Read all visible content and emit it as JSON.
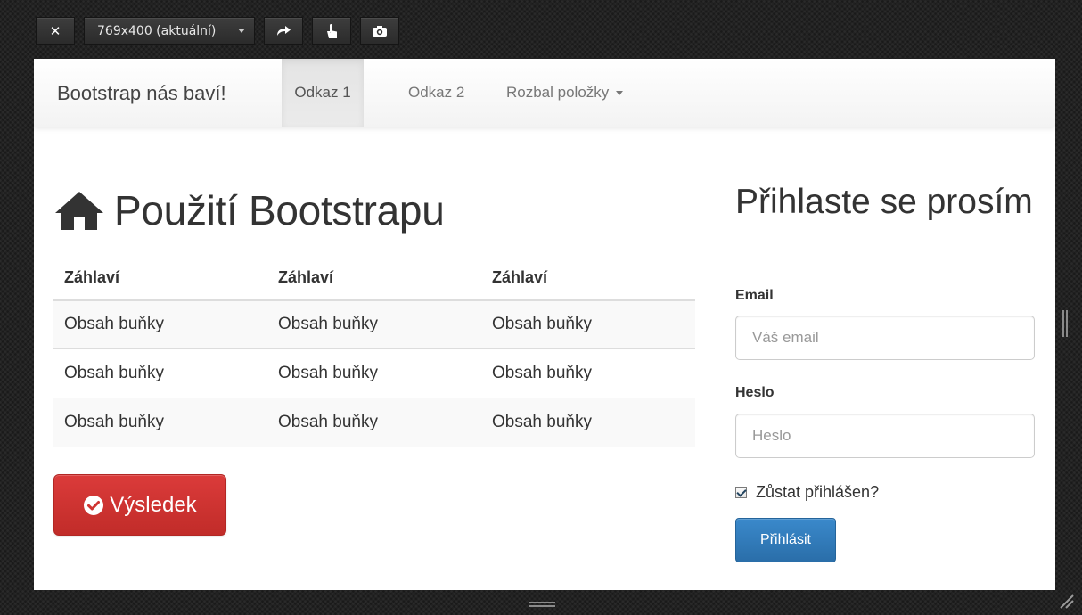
{
  "emulator": {
    "close_icon": "close-icon",
    "viewport_size": "769x400 (aktuální)",
    "icons": [
      "rotate-icon",
      "touch-icon",
      "camera-icon"
    ]
  },
  "navbar": {
    "brand": "Bootstrap nás baví!",
    "links": [
      "Odkaz 1",
      "Odkaz 2",
      "Rozbal položky"
    ],
    "active_index": 0
  },
  "main": {
    "title": "Použití Bootstrapu",
    "title_icon": "home-icon",
    "table": {
      "headers": [
        "Záhlaví",
        "Záhlaví",
        "Záhlaví"
      ],
      "rows": [
        [
          "Obsah buňky",
          "Obsah buňky",
          "Obsah buňky"
        ],
        [
          "Obsah buňky",
          "Obsah buňky",
          "Obsah buňky"
        ],
        [
          "Obsah buňky",
          "Obsah buňky",
          "Obsah buňky"
        ]
      ]
    },
    "result_button": {
      "label": "Výsledek",
      "icon": "check-circle-icon",
      "color": "#d9534f"
    }
  },
  "login": {
    "title": "Přihlaste se prosím",
    "email_label": "Email",
    "email_placeholder": "Váš email",
    "password_label": "Heslo",
    "password_placeholder": "Heslo",
    "remember_label": "Zůstat přihlášen?",
    "remember_checked": true,
    "submit_label": "Přihlásit",
    "submit_color": "#337ab7"
  }
}
